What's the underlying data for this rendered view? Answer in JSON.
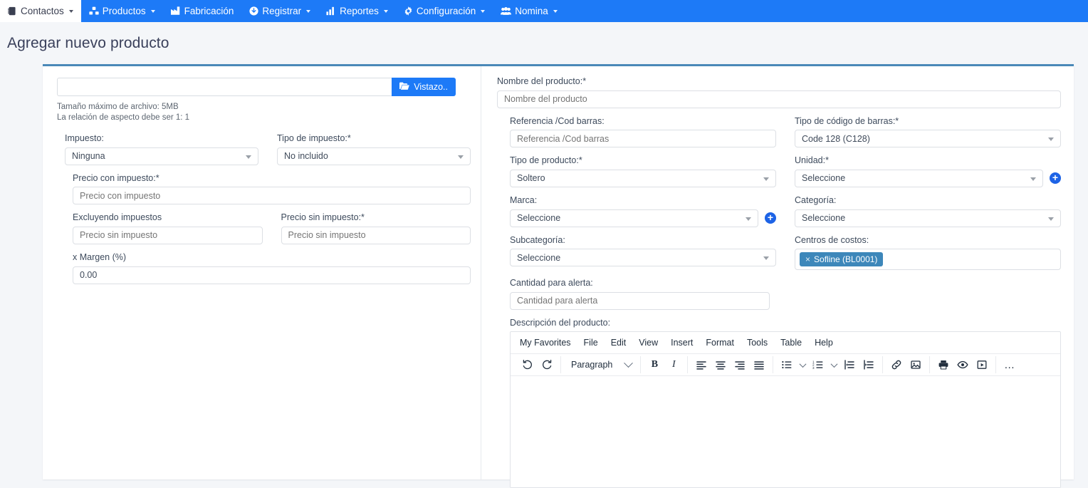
{
  "navbar": {
    "brand_color": "#1d7af7",
    "items": [
      {
        "label": "Contactos",
        "icon": "address-book-icon",
        "caret": true,
        "active": true
      },
      {
        "label": "Productos",
        "icon": "cubes-icon",
        "caret": true,
        "active": false
      },
      {
        "label": "Fabricación",
        "icon": "industry-icon",
        "caret": false,
        "active": false
      },
      {
        "label": "Registrar",
        "icon": "download-icon",
        "caret": true,
        "active": false
      },
      {
        "label": "Reportes",
        "icon": "chart-bar-icon",
        "caret": true,
        "active": false
      },
      {
        "label": "Configuración",
        "icon": "gear-icon",
        "caret": true,
        "active": false
      },
      {
        "label": "Nomina",
        "icon": "users-icon",
        "caret": true,
        "active": false
      }
    ]
  },
  "page": {
    "title": "Agregar nuevo producto",
    "card_accent": "#4a89b8"
  },
  "left": {
    "upload": {
      "file_value": "",
      "browse_label": "Vistazo..",
      "browse_icon": "folder-open-icon"
    },
    "hints": [
      "Tamaño máximo de archivo: 5MB",
      "La relación de aspecto debe ser 1: 1"
    ],
    "impuesto": {
      "label": "Impuesto:",
      "value": "Ninguna"
    },
    "tipo_impuesto": {
      "label": "Tipo de impuesto:*",
      "value": "No incluido"
    },
    "precio_con_impuesto": {
      "label": "Precio con impuesto:*",
      "value": "",
      "placeholder": "Precio con impuesto"
    },
    "excluyendo_impuestos": {
      "label": "Excluyendo impuestos",
      "value": "",
      "placeholder": "Precio sin impuesto"
    },
    "precio_sin_impuesto": {
      "label": "Precio sin impuesto:*",
      "value": "",
      "placeholder": "Precio sin impuesto"
    },
    "margen": {
      "label": "x Margen (%)",
      "value": "0.00"
    }
  },
  "right": {
    "nombre": {
      "label": "Nombre del producto:*",
      "value": "",
      "placeholder": "Nombre del producto"
    },
    "referencia": {
      "label": "Referencia /Cod barras:",
      "value": "",
      "placeholder": "Referencia /Cod barras"
    },
    "tipo_codigo": {
      "label": "Tipo de código de barras:*",
      "value": "Code 128 (C128)"
    },
    "tipo_producto": {
      "label": "Tipo de producto:*",
      "value": "Soltero"
    },
    "unidad": {
      "label": "Unidad:*",
      "value": "Seleccione",
      "add_icon": "plus-circle-icon"
    },
    "marca": {
      "label": "Marca:",
      "value": "Seleccione",
      "add_icon": "plus-circle-icon"
    },
    "categoria": {
      "label": "Categoría:",
      "value": "Seleccione"
    },
    "subcategoria": {
      "label": "Subcategoría:",
      "value": "Seleccione"
    },
    "centros_costos": {
      "label": "Centros de costos:",
      "tags": [
        {
          "remove": "×",
          "text": "Sofline (BL0001)",
          "color": "#3d87ba"
        }
      ]
    },
    "cantidad_alerta": {
      "label": "Cantidad para alerta:",
      "value": "",
      "placeholder": "Cantidad para alerta"
    },
    "descripcion": {
      "label": "Descripción del producto:"
    }
  },
  "editor": {
    "menu": [
      "My Favorites",
      "File",
      "Edit",
      "View",
      "Insert",
      "Format",
      "Tools",
      "Table",
      "Help"
    ],
    "format_select": "Paragraph",
    "content": "",
    "buttons": [
      {
        "name": "undo-icon",
        "glyph": "undo"
      },
      {
        "name": "redo-icon",
        "glyph": "redo"
      },
      {
        "name": "bold-icon",
        "glyph": "B"
      },
      {
        "name": "italic-icon",
        "glyph": "I"
      },
      {
        "name": "align-left-icon",
        "glyph": "align-left"
      },
      {
        "name": "align-center-icon",
        "glyph": "align-center"
      },
      {
        "name": "align-right-icon",
        "glyph": "align-right"
      },
      {
        "name": "align-justify-icon",
        "glyph": "align-justify"
      },
      {
        "name": "bullet-list-icon",
        "glyph": "ul"
      },
      {
        "name": "numbered-list-icon",
        "glyph": "ol"
      },
      {
        "name": "outdent-icon",
        "glyph": "outdent"
      },
      {
        "name": "indent-icon",
        "glyph": "indent"
      },
      {
        "name": "link-icon",
        "glyph": "link"
      },
      {
        "name": "image-icon",
        "glyph": "image"
      },
      {
        "name": "print-icon",
        "glyph": "print"
      },
      {
        "name": "preview-icon",
        "glyph": "eye"
      },
      {
        "name": "media-icon",
        "glyph": "media"
      },
      {
        "name": "more-options-icon",
        "glyph": "…"
      }
    ]
  }
}
